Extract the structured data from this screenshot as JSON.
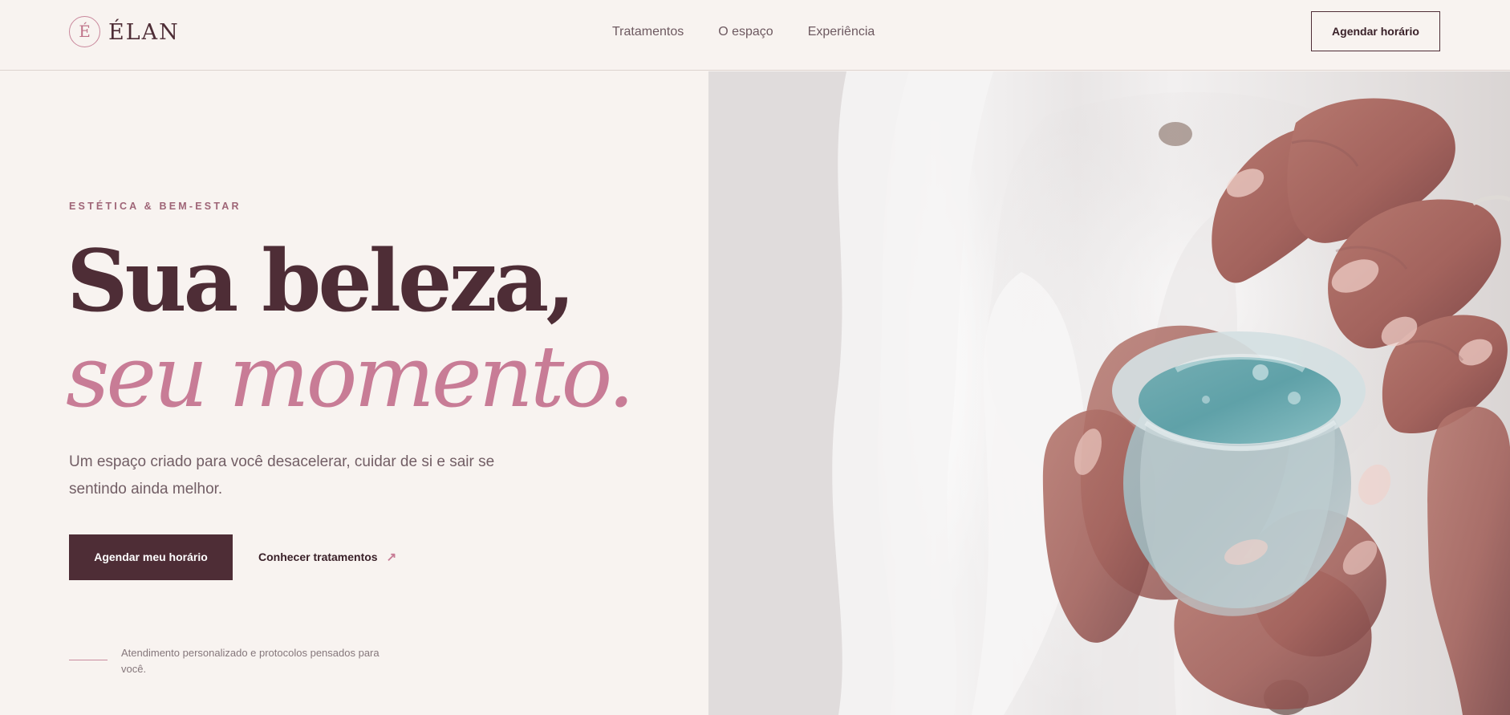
{
  "brand": {
    "mark": "É",
    "name": "ÉLAN"
  },
  "nav": {
    "items": [
      "Tratamentos",
      "O espaço",
      "Experiência"
    ],
    "cta_label": "Agendar horário"
  },
  "hero": {
    "eyebrow": "ESTÉTICA & BEM-ESTAR",
    "headline_line_1": "Sua beleza,",
    "headline_line_2": "seu momento.",
    "intro": "Um espaço criado para você desacelerar, cuidar de si e sair se sentindo ainda melhor.",
    "primary_cta_label": "Agendar meu horário",
    "secondary_cta_label": "Conhecer tratamentos",
    "secondary_cta_icon": "arrow-up-right-icon",
    "secondary_cta_glyph": "↗",
    "note": "Atendimento personalizado e protocolos pensados para você."
  },
  "colors": {
    "background": "#f8f3f0",
    "primary": "#4e2d36",
    "accent": "#c87c96",
    "muted_text": "#725e65"
  }
}
